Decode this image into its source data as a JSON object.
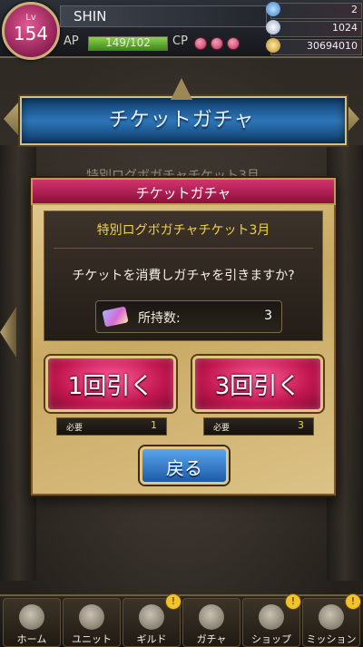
{
  "player": {
    "level_label": "Lv",
    "level": "154",
    "name": "SHIN",
    "ap_label": "AP",
    "ap_value": "149/102",
    "ap_fill": 1.0,
    "cp_label": "CP"
  },
  "resources": [
    {
      "icon": "gem-icon",
      "value": "2"
    },
    {
      "icon": "crystal-icon",
      "value": "1024"
    },
    {
      "icon": "coin-icon",
      "value": "30694010"
    }
  ],
  "banner": {
    "title": "チケットガチャ"
  },
  "background_peek": "特別ログボガチャチケット3月",
  "modal": {
    "title": "チケットガチャ",
    "ticket_name": "特別ログボガチャチケット3月",
    "question": "チケットを消費しガチャを引きますか?",
    "owned_label": "所持数:",
    "owned_value": "3",
    "pull_once_label": "1回引く",
    "pull_three_label": "3回引く",
    "required_label": "必要",
    "required_once": "1",
    "required_three": "3",
    "back_label": "戻る"
  },
  "nav": [
    {
      "label": "ホーム",
      "icon": "home-icon",
      "alert": false
    },
    {
      "label": "ユニット",
      "icon": "unit-icon",
      "alert": false
    },
    {
      "label": "ギルド",
      "icon": "guild-icon",
      "alert": true
    },
    {
      "label": "ガチャ",
      "icon": "gacha-icon",
      "alert": false
    },
    {
      "label": "ショップ",
      "icon": "shop-icon",
      "alert": true
    },
    {
      "label": "ミッション",
      "icon": "mission-icon",
      "alert": true
    }
  ],
  "alert_mark": "!"
}
